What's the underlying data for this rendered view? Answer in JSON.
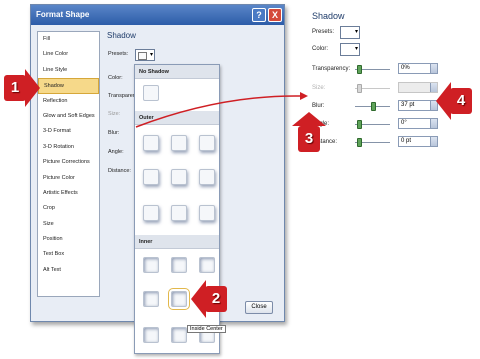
{
  "dialog": {
    "title": "Format Shape",
    "help": "?",
    "close_glyph": "X",
    "close_button": "Close",
    "sidebar": [
      "Fill",
      "Line Color",
      "Line Style",
      "Shadow",
      "Reflection",
      "Glow and Soft Edges",
      "3-D Format",
      "3-D Rotation",
      "Picture Corrections",
      "Picture Color",
      "Artistic Effects",
      "Crop",
      "Size",
      "Position",
      "Text Box",
      "Alt Text"
    ],
    "active_item": "Shadow",
    "section_title": "Shadow",
    "labels": {
      "presets": "Presets:",
      "color": "Color:",
      "transparency": "Transparen",
      "size": "Size:",
      "blur": "Blur:",
      "angle": "Angle:",
      "distance": "Distance:"
    }
  },
  "gallery": {
    "no_shadow": "No Shadow",
    "outer": "Outer",
    "inner": "Inner",
    "tooltip": "Inside Center"
  },
  "panel": {
    "title": "Shadow",
    "presets": "Presets:",
    "color": "Color:",
    "transparency": "Transparency:",
    "size": "Size:",
    "blur": "Blur:",
    "angle": "Angle:",
    "distance": "Distance:",
    "transparency_value": "0%",
    "size_value": "",
    "blur_value": "37 pt",
    "angle_value": "0°",
    "distance_value": "0 pt"
  },
  "callouts": {
    "one": "1",
    "two": "2",
    "three": "3",
    "four": "4"
  },
  "colors": {
    "callout": "#cf1f24",
    "selection": "#f6d98a",
    "slider": "#5fa35a"
  }
}
